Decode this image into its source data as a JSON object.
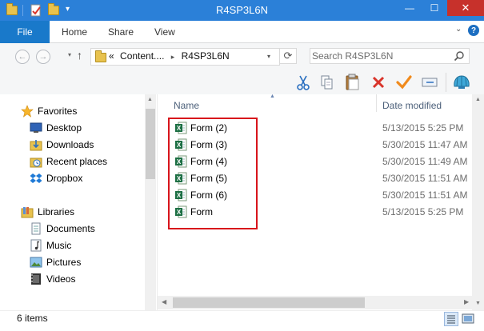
{
  "window": {
    "title": "R4SP3L6N",
    "close_glyph": "✕",
    "minimize_glyph": "—",
    "maximize_glyph": "☐"
  },
  "ribbon": {
    "tabs": [
      {
        "label": "File"
      },
      {
        "label": "Home"
      },
      {
        "label": "Share"
      },
      {
        "label": "View"
      }
    ],
    "help_glyph": "?"
  },
  "address": {
    "overflow": "«",
    "segments": [
      "Content....",
      "R4SP3L6N"
    ],
    "separator": "▸",
    "refresh_glyph": "⟳"
  },
  "search": {
    "placeholder": "Search R4SP3L6N"
  },
  "navigation": {
    "favorites": [
      {
        "label": "Favorites",
        "icon": "star-icon"
      },
      {
        "label": "Desktop",
        "icon": "desktop-icon"
      },
      {
        "label": "Downloads",
        "icon": "downloads-icon"
      },
      {
        "label": "Recent places",
        "icon": "recent-places-icon"
      },
      {
        "label": "Dropbox",
        "icon": "dropbox-icon"
      }
    ],
    "libraries": [
      {
        "label": "Libraries",
        "icon": "libraries-icon"
      },
      {
        "label": "Documents",
        "icon": "documents-icon"
      },
      {
        "label": "Music",
        "icon": "music-icon"
      },
      {
        "label": "Pictures",
        "icon": "pictures-icon"
      },
      {
        "label": "Videos",
        "icon": "videos-icon"
      }
    ]
  },
  "columns": {
    "name": "Name",
    "date_modified": "Date modified"
  },
  "files": [
    {
      "name": "Form (2)",
      "date": "5/13/2015 5:25 PM"
    },
    {
      "name": "Form (3)",
      "date": "5/30/2015 11:47 AM"
    },
    {
      "name": "Form (4)",
      "date": "5/30/2015 11:49 AM"
    },
    {
      "name": "Form (5)",
      "date": "5/30/2015 11:51 AM"
    },
    {
      "name": "Form (6)",
      "date": "5/30/2015 11:51 AM"
    },
    {
      "name": "Form",
      "date": "5/13/2015 5:25 PM"
    }
  ],
  "status": {
    "item_count": "6 items"
  },
  "colors": {
    "title_bar": "#2b80d8",
    "file_tab": "#1979ca",
    "highlight_border": "#d8141b",
    "excel_green": "#1d7044"
  }
}
